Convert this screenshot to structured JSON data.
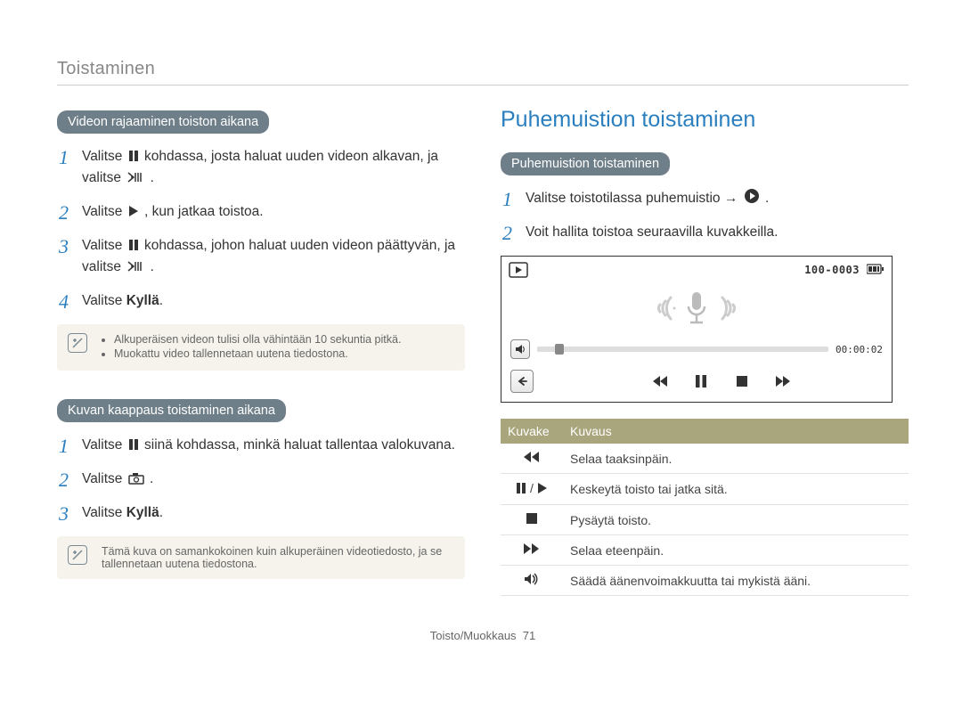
{
  "header": {
    "section": "Toistaminen"
  },
  "left": {
    "trim": {
      "pill": "Videon rajaaminen toiston aikana",
      "steps": [
        {
          "pre": "Valitse ",
          "icon1": "pause",
          "mid": " kohdassa, josta haluat uuden videon alkavan, ja valitse ",
          "icon2": "trim",
          "post": "."
        },
        {
          "pre": "Valitse ",
          "icon1": "play",
          "mid": ", kun jatkaa toistoa.",
          "icon2": null,
          "post": ""
        },
        {
          "pre": "Valitse ",
          "icon1": "pause",
          "mid": " kohdassa, johon haluat uuden videon päättyvän, ja valitse ",
          "icon2": "trim",
          "post": "."
        },
        {
          "pre": "Valitse ",
          "bold": "Kyllä",
          "post": "."
        }
      ],
      "notes": [
        "Alkuperäisen videon tulisi olla vähintään 10 sekuntia pitkä.",
        "Muokattu video tallennetaan uutena tiedostona."
      ]
    },
    "capture": {
      "pill": "Kuvan kaappaus toistaminen aikana",
      "steps": [
        {
          "pre": "Valitse ",
          "icon1": "pause",
          "mid": " siinä kohdassa, minkä haluat tallentaa valokuvana.",
          "icon2": null,
          "post": ""
        },
        {
          "pre": "Valitse ",
          "icon1": "camera",
          "mid": ".",
          "icon2": null,
          "post": ""
        },
        {
          "pre": "Valitse ",
          "bold": "Kyllä",
          "post": "."
        }
      ],
      "note_single": "Tämä kuva on samankokoinen kuin alkuperäinen videotiedosto, ja se tallennetaan uutena tiedostona."
    }
  },
  "right": {
    "heading": "Puhemuistion toistaminen",
    "pill": "Puhemuistion toistaminen",
    "steps": [
      {
        "text": "Valitse toistotilassa puhemuistio → ",
        "icon": "play-circle",
        "post": "."
      },
      {
        "text": "Voit hallita toistoa seuraavilla kuvakkeilla."
      }
    ],
    "player": {
      "id_text": "100-0003",
      "time": "00:00:02"
    },
    "table": {
      "head": {
        "col1": "Kuvake",
        "col2": "Kuvaus"
      },
      "rows": [
        {
          "icon": "rewind",
          "desc": "Selaa taaksinpäin."
        },
        {
          "icon": "pause-play",
          "desc": "Keskeytä toisto tai jatka sitä."
        },
        {
          "icon": "stop",
          "desc": "Pysäytä toisto."
        },
        {
          "icon": "forward",
          "desc": "Selaa eteenpäin."
        },
        {
          "icon": "volume",
          "desc": "Säädä äänenvoimakkuutta tai mykistä ääni."
        }
      ]
    }
  },
  "footer": {
    "label": "Toisto/Muokkaus",
    "page": "71"
  }
}
